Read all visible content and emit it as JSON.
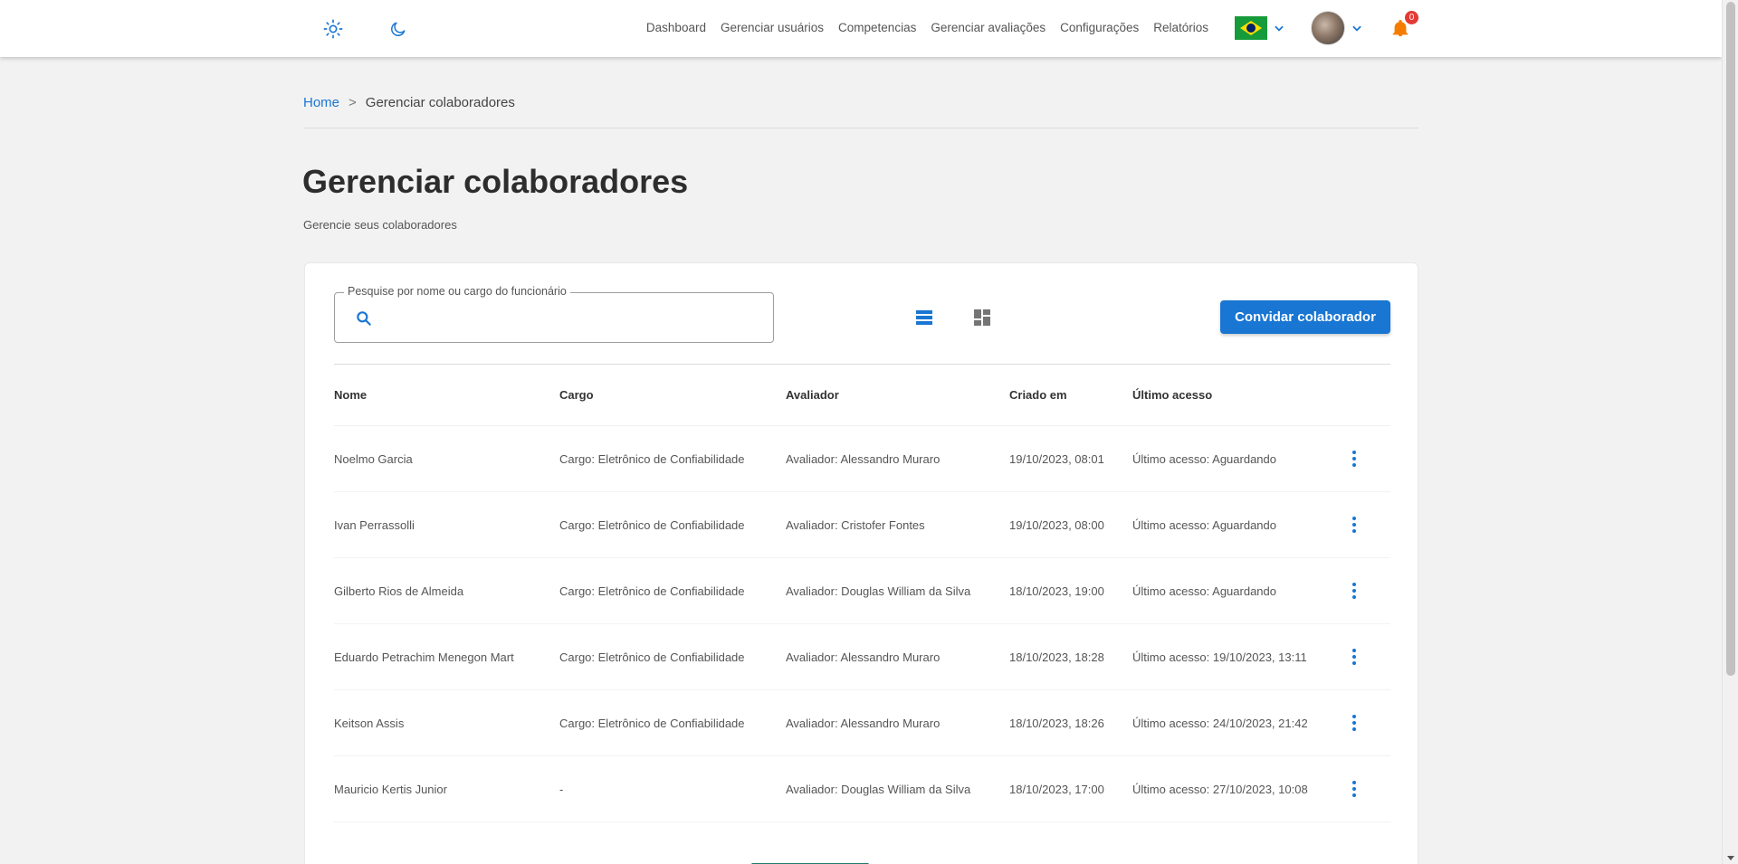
{
  "header": {
    "nav": [
      "Dashboard",
      "Gerenciar usuários",
      "Competencias",
      "Gerenciar avaliações",
      "Configurações",
      "Relatórios"
    ],
    "notification_count": "0"
  },
  "breadcrumb": {
    "home": "Home",
    "separator": ">",
    "current": "Gerenciar colaboradores"
  },
  "page": {
    "title": "Gerenciar colaboradores",
    "subtitle": "Gerencie seus colaboradores"
  },
  "search": {
    "label": "Pesquise por nome ou cargo do funcionário",
    "value": "",
    "placeholder": ""
  },
  "actions": {
    "invite_label": "Convidar colaborador"
  },
  "table": {
    "columns": [
      "Nome",
      "Cargo",
      "Avaliador",
      "Criado em",
      "Último acesso"
    ],
    "rows": [
      [
        "Noelmo Garcia",
        "Cargo: Eletrônico de Confiabilidade",
        "Avaliador: Alessandro Muraro",
        "19/10/2023, 08:01",
        "Último acesso: Aguardando"
      ],
      [
        "Ivan Perrassolli",
        "Cargo: Eletrônico de Confiabilidade",
        "Avaliador: Cristofer Fontes",
        "19/10/2023, 08:00",
        "Último acesso: Aguardando"
      ],
      [
        "Gilberto Rios de Almeida",
        "Cargo: Eletrônico de Confiabilidade",
        "Avaliador: Douglas William da Silva",
        "18/10/2023, 19:00",
        "Último acesso: Aguardando"
      ],
      [
        "Eduardo Petrachim Menegon Mart",
        "Cargo: Eletrônico de Confiabilidade",
        "Avaliador: Alessandro Muraro",
        "18/10/2023, 18:28",
        "Último acesso: 19/10/2023, 13:11"
      ],
      [
        "Keitson Assis",
        "Cargo: Eletrônico de Confiabilidade",
        "Avaliador: Alessandro Muraro",
        "18/10/2023, 18:26",
        "Último acesso: 24/10/2023, 21:42"
      ],
      [
        "Mauricio Kertis Junior",
        "-",
        "Avaliador: Douglas William da Silva",
        "18/10/2023, 17:00",
        "Último acesso: 27/10/2023, 10:08"
      ]
    ]
  },
  "colors": {
    "accent": "#1976d2",
    "bell": "#f57c00",
    "badge": "#e53935"
  }
}
